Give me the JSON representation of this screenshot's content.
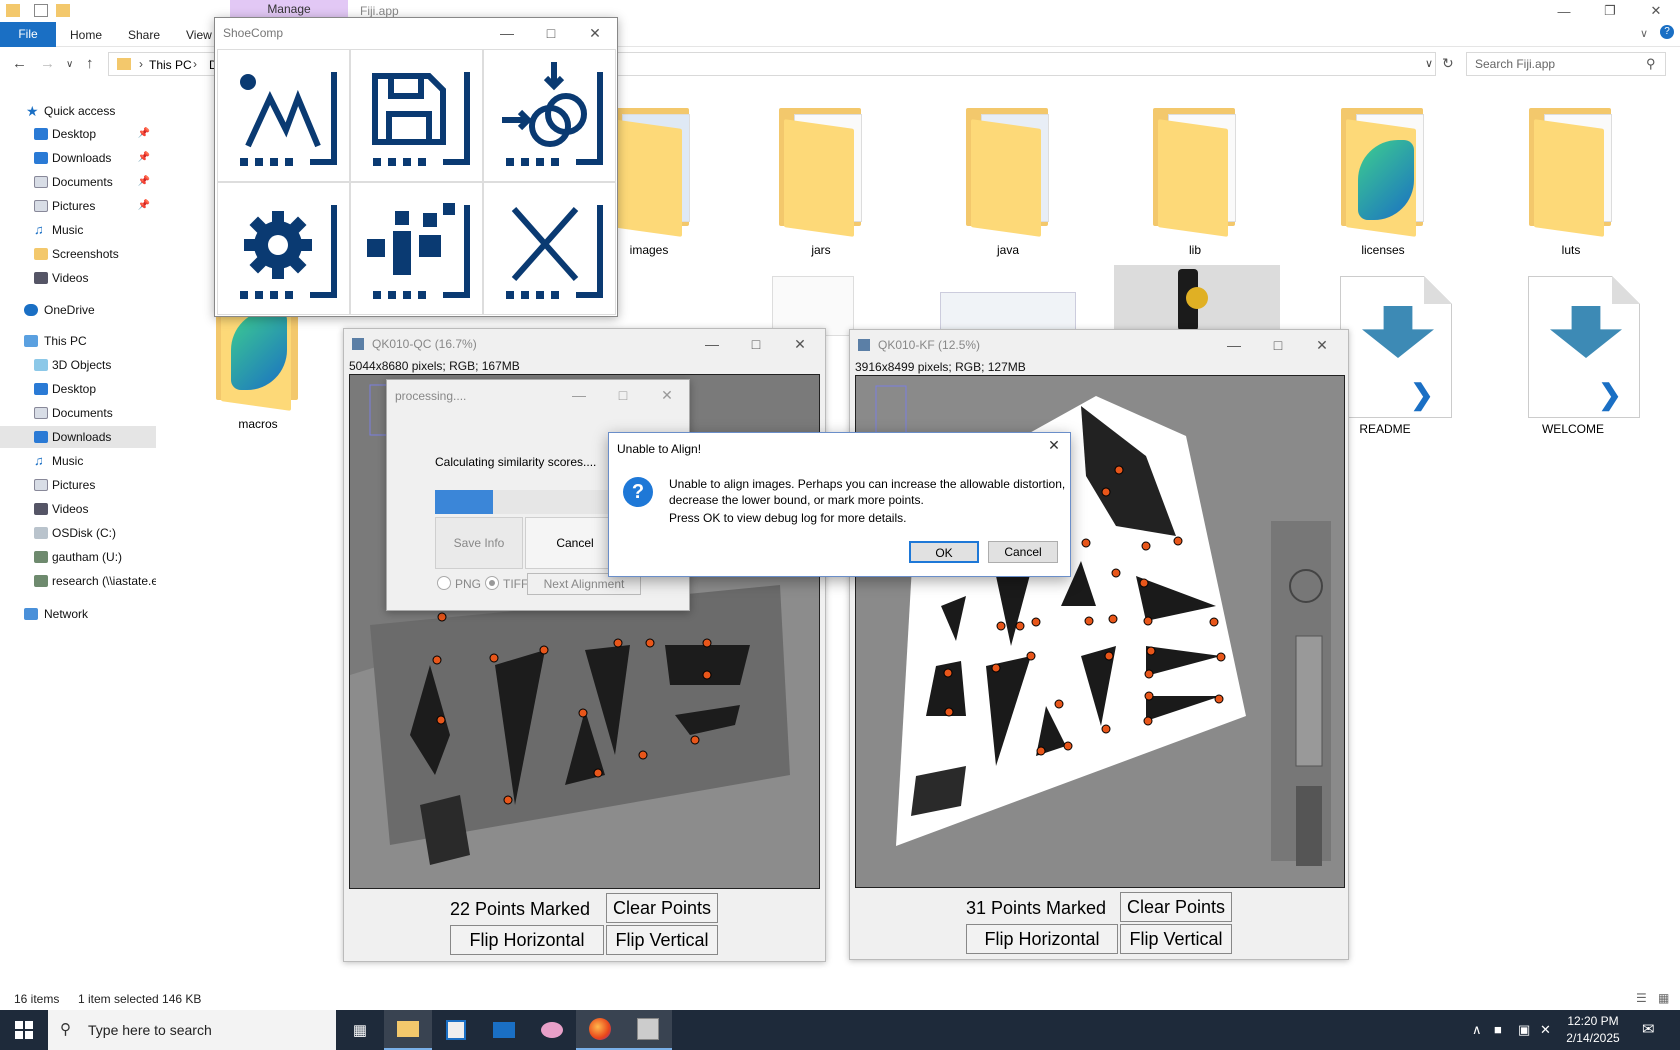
{
  "explorer": {
    "manage_tab": "Manage",
    "window_title": "Fiji.app",
    "ribbon_tabs": [
      "File",
      "Home",
      "Share",
      "View"
    ],
    "breadcrumb": {
      "root": "This PC",
      "partial": "D"
    },
    "search_placeholder": "Search Fiji.app",
    "status": {
      "items": "16 items",
      "selected": "1 item selected  146 KB"
    }
  },
  "nav": {
    "quick_access": "Quick access",
    "quick_items": [
      "Desktop",
      "Downloads",
      "Documents",
      "Pictures",
      "Music",
      "Screenshots",
      "Videos"
    ],
    "onedrive": "OneDrive",
    "this_pc": "This PC",
    "pc_items": [
      "3D Objects",
      "Desktop",
      "Documents",
      "Downloads",
      "Music",
      "Pictures",
      "Videos",
      "OSDisk (C:)",
      "gautham (U:)",
      "research (\\\\iastate.e"
    ],
    "network": "Network"
  },
  "files": [
    "images",
    "jars",
    "java",
    "lib",
    "licenses",
    "luts",
    "macros",
    "README",
    "WELCOME"
  ],
  "shoecomp": {
    "title": "ShoeComp",
    "tools": [
      "mark-points-icon",
      "save-icon",
      "align-icon",
      "settings-icon",
      "info-icon",
      "close-tool-icon"
    ]
  },
  "window_left": {
    "title": "QK010-QC (16.7%)",
    "info": "5044x8680 pixels; RGB; 167MB",
    "points_marked": "22 Points Marked",
    "clear_points": "Clear Points",
    "flip_h": "Flip Horizontal",
    "flip_v": "Flip Vertical"
  },
  "window_right": {
    "title": "QK010-KF (12.5%)",
    "info": "3916x8499 pixels; RGB; 127MB",
    "points_marked": "31 Points Marked",
    "clear_points": "Clear Points",
    "flip_h": "Flip Horizontal",
    "flip_v": "Flip Vertical"
  },
  "processing": {
    "title": "processing....",
    "message": "Calculating similarity scores....",
    "progress": 0.29,
    "save_info": "Save Info",
    "cancel": "Cancel",
    "png": "PNG",
    "tiff": "TIFF",
    "next_alignment": "Next Alignment"
  },
  "alert": {
    "title": "Unable to Align!",
    "line1": "Unable to align images. Perhaps you can increase the allowable distortion,",
    "line2": "decrease the lower bound, or mark more points.",
    "line3": "Press OK to view debug log for more details.",
    "ok": "OK",
    "cancel": "Cancel"
  },
  "taskbar": {
    "search_placeholder": "Type here to search",
    "time": "12:20 PM",
    "date": "2/14/2025"
  },
  "colors": {
    "accent": "#1a6fc4",
    "tool_icon": "#0a3a72",
    "marker": "#e8561a",
    "folder": "#f3c86c"
  }
}
